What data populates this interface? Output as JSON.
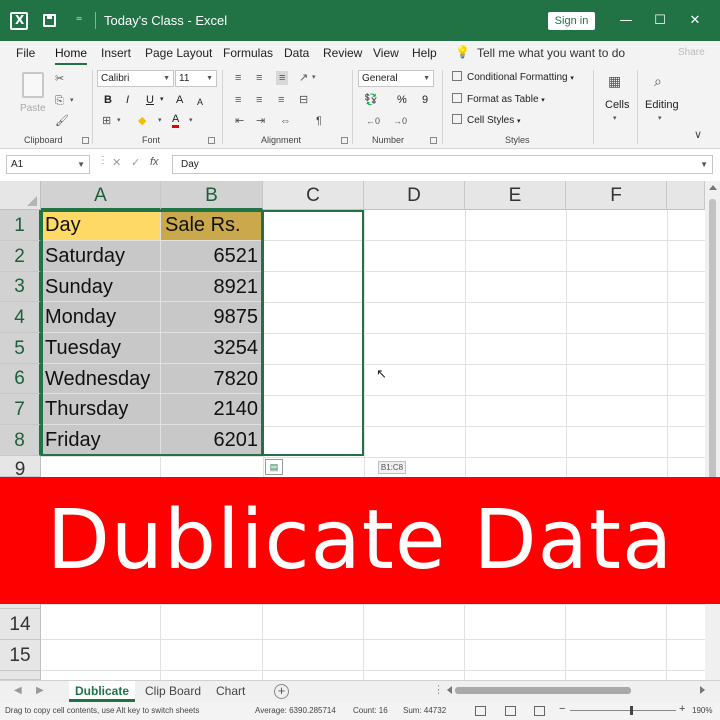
{
  "titlebar": {
    "doc_title": "Today's Class  -  Excel",
    "signin_label": "Sign in",
    "colors": {
      "brand": "#217346"
    }
  },
  "menu": {
    "tabs": [
      "File",
      "Home",
      "Insert",
      "Page Layout",
      "Formulas",
      "Data",
      "Review",
      "View",
      "Help"
    ],
    "active_tab": "Home",
    "tell_me": "Tell me what you want to do",
    "share": "Share"
  },
  "ribbon": {
    "clipboard": {
      "paste_label": "Paste",
      "group_label": "Clipboard"
    },
    "font": {
      "font_name": "Calibri",
      "font_size": "11",
      "bold": "B",
      "italic": "I",
      "underline": "U",
      "font_color_letter": "A",
      "group_label": "Font"
    },
    "alignment": {
      "group_label": "Alignment"
    },
    "number": {
      "format": "General",
      "percent": "%",
      "comma": "9",
      "group_label": "Number"
    },
    "styles": {
      "conditional_formatting": "Conditional Formatting",
      "format_as_table": "Format as Table",
      "cell_styles": "Cell Styles",
      "group_label": "Styles"
    },
    "cells_label": "Cells",
    "editing_label": "Editing"
  },
  "formula_bar": {
    "name_box": "A1",
    "cancel": "✕",
    "enter": "✓",
    "fx": "fx",
    "content": "Day"
  },
  "grid": {
    "columns": [
      "A",
      "B",
      "C",
      "D",
      "E",
      "F"
    ],
    "visible_rows_top": [
      "1",
      "2",
      "3",
      "4",
      "5",
      "6",
      "7",
      "8",
      "9"
    ],
    "visible_rows_bottom": [
      "14",
      "15"
    ],
    "header": {
      "day": "Day",
      "sale": "Sale Rs."
    },
    "rows": [
      {
        "day": "Saturday",
        "sale": "6521"
      },
      {
        "day": "Sunday",
        "sale": "8921"
      },
      {
        "day": "Monday",
        "sale": "9875"
      },
      {
        "day": "Tuesday",
        "sale": "3254"
      },
      {
        "day": "Wednesday",
        "sale": "7820"
      },
      {
        "day": "Thursday",
        "sale": "2140"
      },
      {
        "day": "Friday",
        "sale": "6201"
      }
    ],
    "drag_tooltip": "B1:C8",
    "colors": {
      "header_a": "#ffd966",
      "header_b": "#c9a94c",
      "data_fill": "#c8c8c8"
    }
  },
  "banner": {
    "text": "Dublicate Data",
    "color": "#ff0000"
  },
  "sheets": {
    "tabs": [
      "Dublicate",
      "Clip Board",
      "Chart"
    ],
    "active": "Dublicate"
  },
  "statusbar": {
    "message": "Drag to copy cell contents, use Alt key to switch sheets",
    "average": "Average: 6390.285714",
    "count": "Count: 16",
    "sum": "Sum: 44732",
    "zoom": "190%"
  }
}
